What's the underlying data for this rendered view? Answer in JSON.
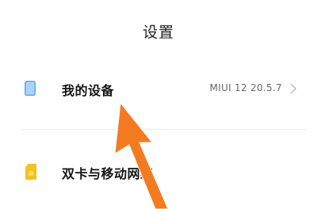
{
  "header": {
    "title": "设置"
  },
  "items": [
    {
      "label": "我的设备",
      "value": "MIUI 12 20.5.7",
      "icon": "phone-icon"
    },
    {
      "label": "双卡与移动网络",
      "icon": "sim-card-icon"
    }
  ],
  "annotation": {
    "arrow_color": "#f47a20",
    "icon": "arrow-annotation"
  },
  "colors": {
    "device_icon": "#5aa9f0",
    "sim_icon": "#f5c21b"
  }
}
